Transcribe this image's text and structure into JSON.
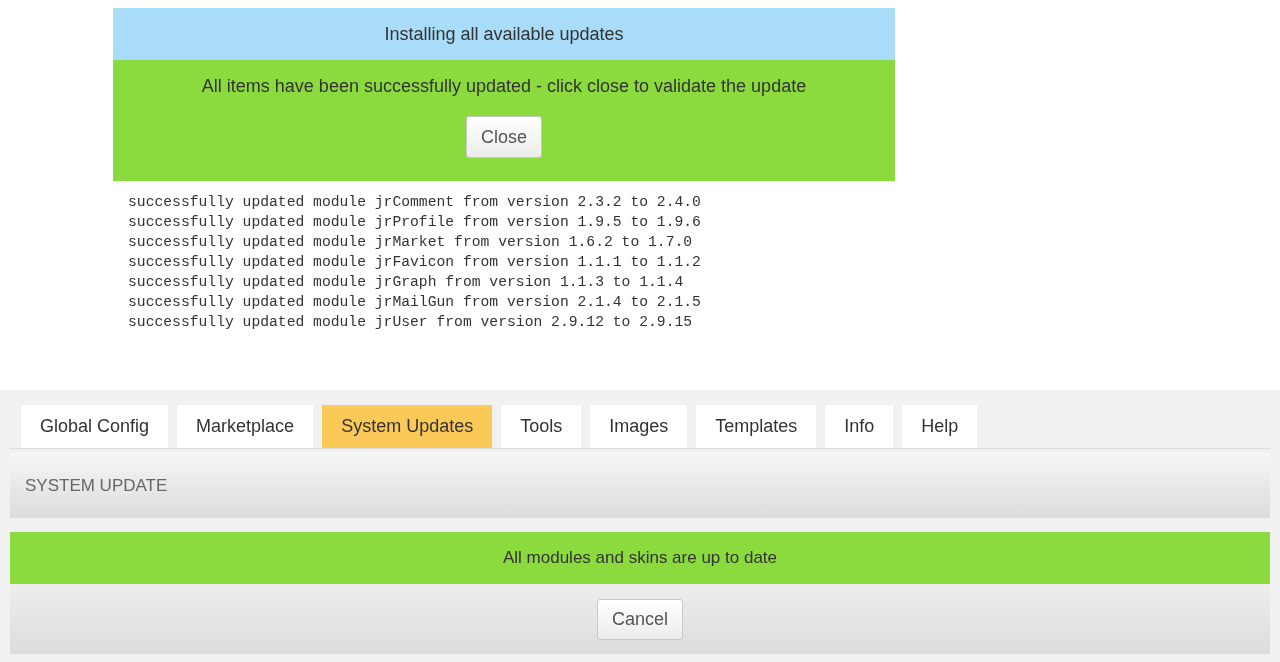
{
  "update_dialog": {
    "title": "Installing all available updates",
    "message": "All items have been successfully updated - click close to validate the update",
    "button": "Close"
  },
  "log_lines": [
    "successfully updated module jrComment from version 2.3.2 to 2.4.0",
    "successfully updated module jrProfile from version 1.9.5 to 1.9.6",
    "successfully updated module jrMarket from version 1.6.2 to 1.7.0",
    "successfully updated module jrFavicon from version 1.1.1 to 1.1.2",
    "successfully updated module jrGraph from version 1.1.3 to 1.1.4",
    "successfully updated module jrMailGun from version 2.1.4 to 2.1.5",
    "successfully updated module jrUser from version 2.9.12 to 2.9.15"
  ],
  "tabs": [
    {
      "label": "Global Config",
      "selected": false
    },
    {
      "label": "Marketplace",
      "selected": false
    },
    {
      "label": "System Updates",
      "selected": true
    },
    {
      "label": "Tools",
      "selected": false
    },
    {
      "label": "Images",
      "selected": false
    },
    {
      "label": "Templates",
      "selected": false
    },
    {
      "label": "Info",
      "selected": false
    },
    {
      "label": "Help",
      "selected": false
    }
  ],
  "panel": {
    "title": "SYSTEM UPDATE",
    "status": "All modules and skins are up to date",
    "button": "Cancel"
  }
}
